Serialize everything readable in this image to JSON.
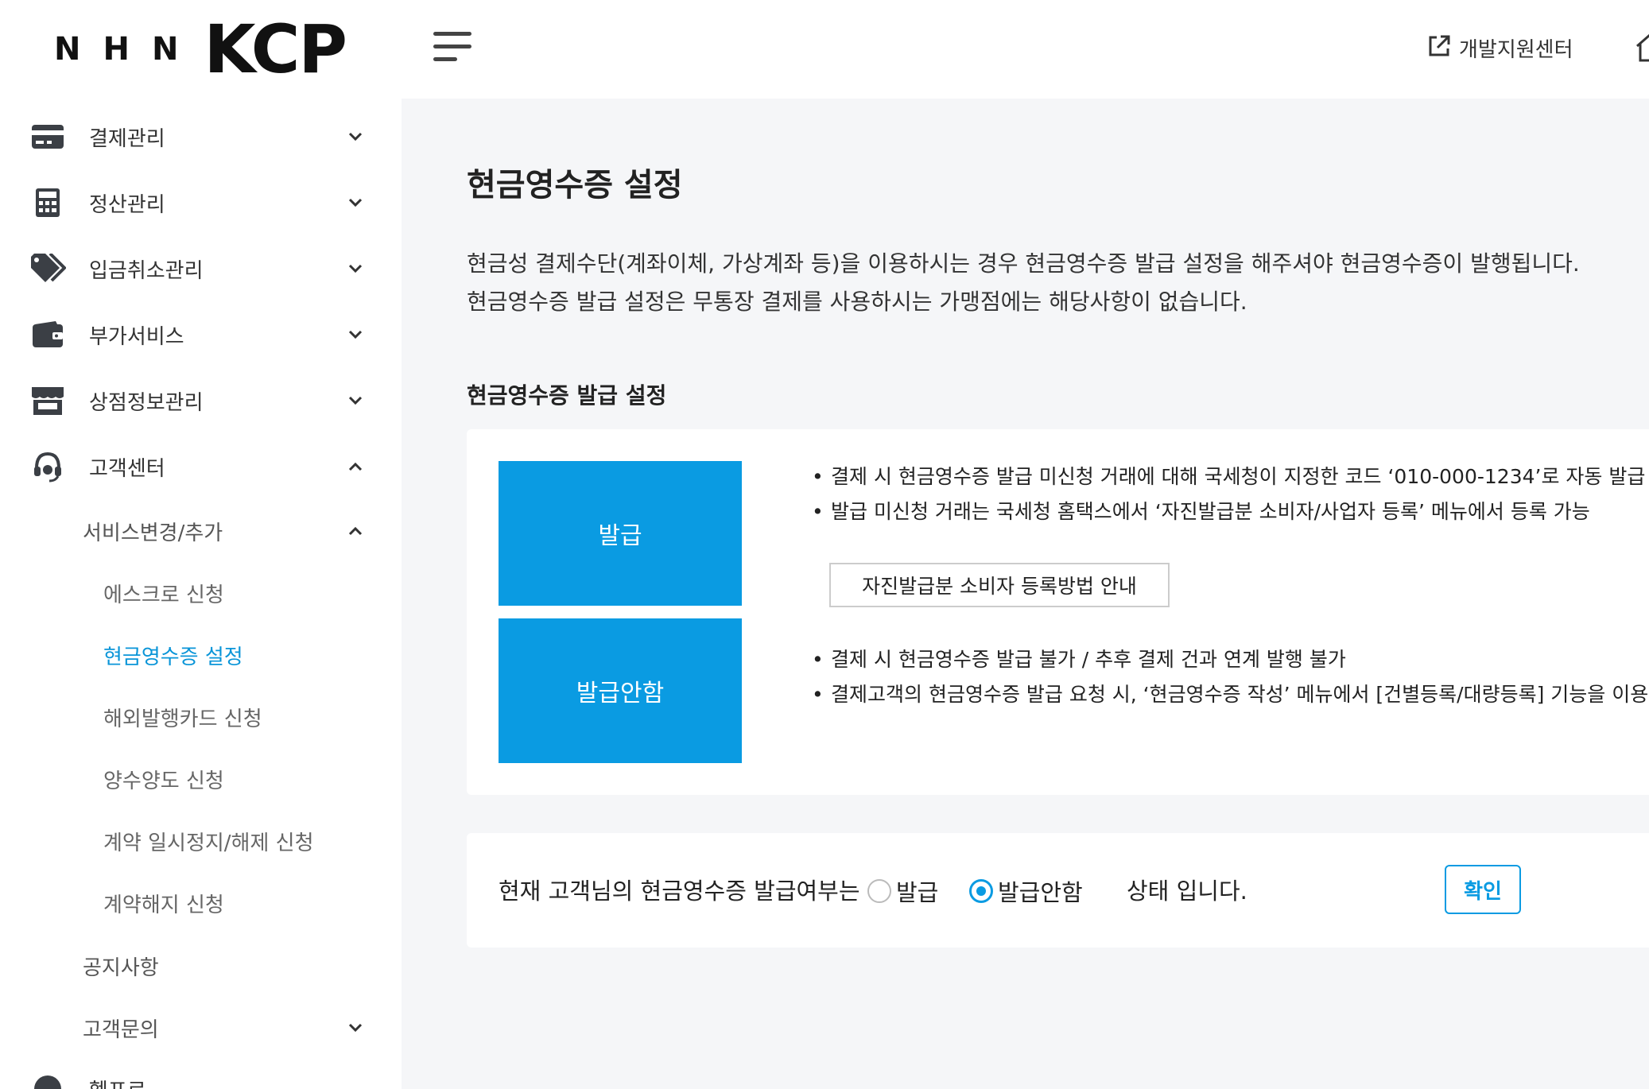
{
  "logo": {
    "nhn": "NHN",
    "kcp": "KCP"
  },
  "sidebar": {
    "menu": [
      {
        "label": "결제관리",
        "icon": "credit-card-icon",
        "expanded": false
      },
      {
        "label": "정산관리",
        "icon": "calculator-icon",
        "expanded": false
      },
      {
        "label": "입금취소관리",
        "icon": "tag-icon",
        "expanded": false
      },
      {
        "label": "부가서비스",
        "icon": "wallet-icon",
        "expanded": false
      },
      {
        "label": "상점정보관리",
        "icon": "store-icon",
        "expanded": false
      },
      {
        "label": "고객센터",
        "icon": "headset-icon",
        "expanded": true
      }
    ],
    "sub_service": {
      "label": "서비스변경/추가",
      "expanded": true
    },
    "leaves": [
      {
        "label": "에스크로 신청",
        "active": false
      },
      {
        "label": "현금영수증 설정",
        "active": true
      },
      {
        "label": "해외발행카드 신청",
        "active": false
      },
      {
        "label": "양수양도 신청",
        "active": false
      },
      {
        "label": "계약 일시정지/해제 신청",
        "active": false
      },
      {
        "label": "계약해지 신청",
        "active": false
      }
    ],
    "notice": {
      "label": "공지사항"
    },
    "inquiry": {
      "label": "고객문의",
      "expanded": false
    },
    "partial_item": {
      "label": "헬프로"
    }
  },
  "header": {
    "dev_center_label": "개발지원센터"
  },
  "main": {
    "title": "현금영수증 설정",
    "desc_line1": "현금성 결제수단(계좌이체, 가상계좌 등)을 이용하시는 경우 현금영수증 발급 설정을 해주셔야 현금영수증이 발행됩니다.",
    "desc_line2": "현금영수증 발급 설정은 무통장 결제를 사용하시는 가맹점에는 해당사항이 없습니다.",
    "section_title": "현금영수증 발급 설정",
    "issue_option": {
      "label": "발급",
      "bullets": [
        "결제 시 현금영수증 발급 미신청 거래에 대해 국세청이 지정한 코드 ‘010-000-1234’로 자동 발급",
        "발급 미신청 거래는 국세청 홈택스에서 ‘자진발급분 소비자/사업자 등록’ 메뉴에서 등록 가능"
      ],
      "guide_button": "자진발급분 소비자 등록방법 안내"
    },
    "no_issue_option": {
      "label": "발급안함",
      "bullets": [
        "결제 시 현금영수증 발급 불가 / 추후 결제 건과 연계 발행 불가",
        "결제고객의 현금영수증 발급 요청 시, ‘현금영수증 작성’ 메뉴에서 [건별등록/대량등록] 기능을 이용"
      ]
    },
    "status": {
      "prefix": "현재 고객님의 현금영수증 발급여부는",
      "radio_issue": "발급",
      "radio_no_issue": "발급안함",
      "selected": "발급안함",
      "suffix": "상태 입니다.",
      "confirm": "확인"
    }
  },
  "colors": {
    "accent": "#0a9be2",
    "active_link": "#0a95d8",
    "background": "#f5f6f8"
  }
}
